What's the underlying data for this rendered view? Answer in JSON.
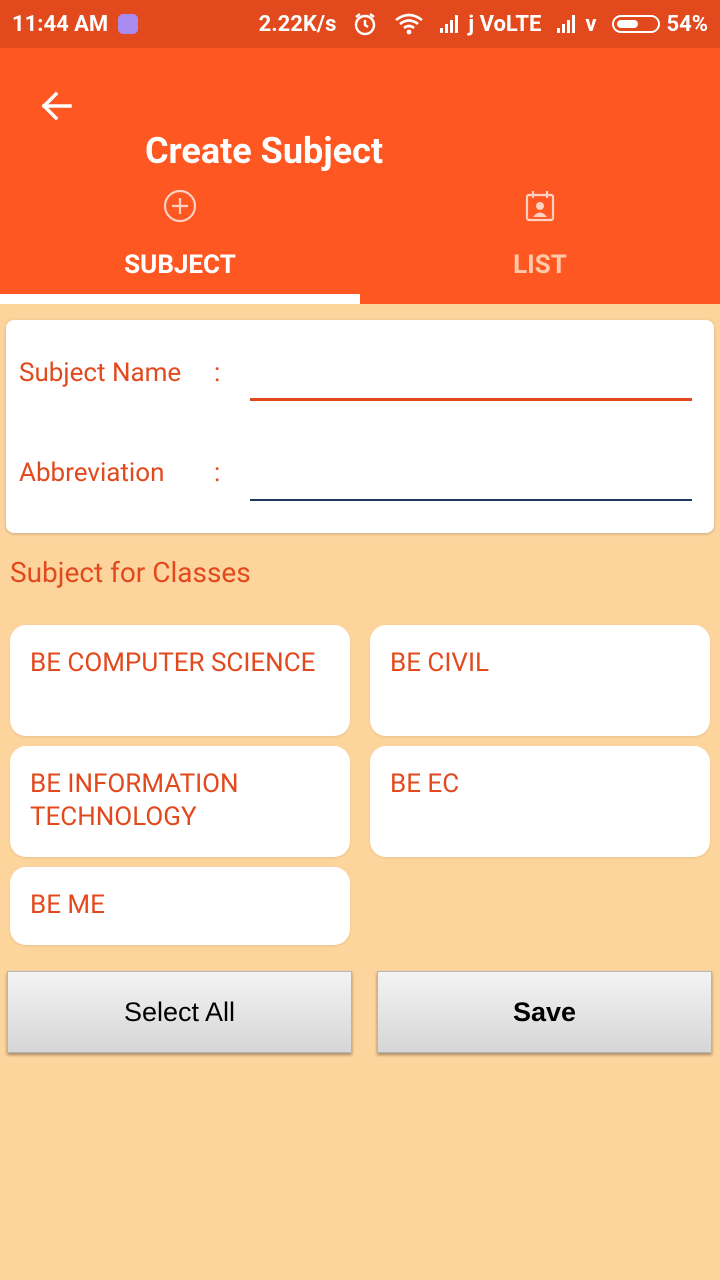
{
  "status_bar": {
    "time": "11:44 AM",
    "net_speed": "2.22K/s",
    "carrier": "j VoLTE",
    "carrier2": "v",
    "battery": "54%",
    "battery_level": 0.54
  },
  "app_bar": {
    "title": "Create Subject",
    "back_icon": "arrow-back-icon"
  },
  "tabs": [
    {
      "label": "SUBJECT",
      "icon": "add-circle-icon",
      "selected": true
    },
    {
      "label": "LIST",
      "icon": "calendar-person-icon",
      "selected": false
    }
  ],
  "form": {
    "subject_name_label": "Subject Name",
    "abbreviation_label": "Abbreviation",
    "colon": ":",
    "subject_name_value": "",
    "abbreviation_value": ""
  },
  "classes": {
    "title": "Subject for Classes",
    "items": [
      {
        "label": "BE COMPUTER SCIENCE"
      },
      {
        "label": "BE CIVIL"
      },
      {
        "label": "BE INFORMATION TECHNOLOGY"
      },
      {
        "label": "BE EC"
      },
      {
        "label": "BE ME"
      }
    ]
  },
  "buttons": {
    "select_all": "Select All",
    "save": "Save"
  },
  "colors": {
    "primary": "#fe5722",
    "status_bar": "#e2491d",
    "accent_text": "#e2491d",
    "background": "#fdd49c"
  }
}
